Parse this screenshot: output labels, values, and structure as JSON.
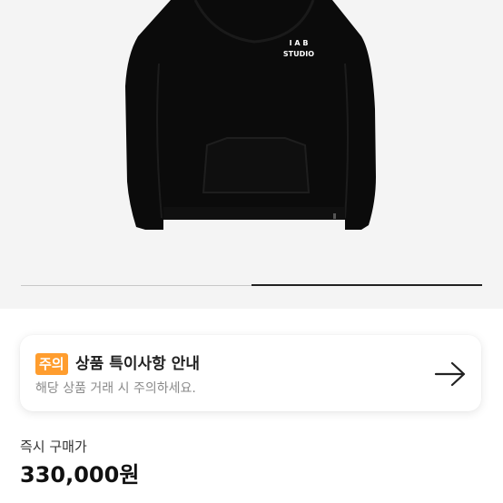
{
  "product": {
    "image_alt": "black hoodie",
    "logo_line1": "I A B",
    "logo_line2": "STUDIO",
    "gallery_progress_fraction": 0.5
  },
  "notice": {
    "badge": "주의",
    "title": "상품 특이사항 안내",
    "description": "해당 상품 거래 시 주의하세요.",
    "arrow_icon": "arrow-right-icon"
  },
  "price": {
    "label": "즉시 구매가",
    "value": "330,000원"
  },
  "colors": {
    "badge": "#ff9d2e",
    "image_background": "#f4f4f4",
    "hoodie": "#0b0b0b"
  }
}
